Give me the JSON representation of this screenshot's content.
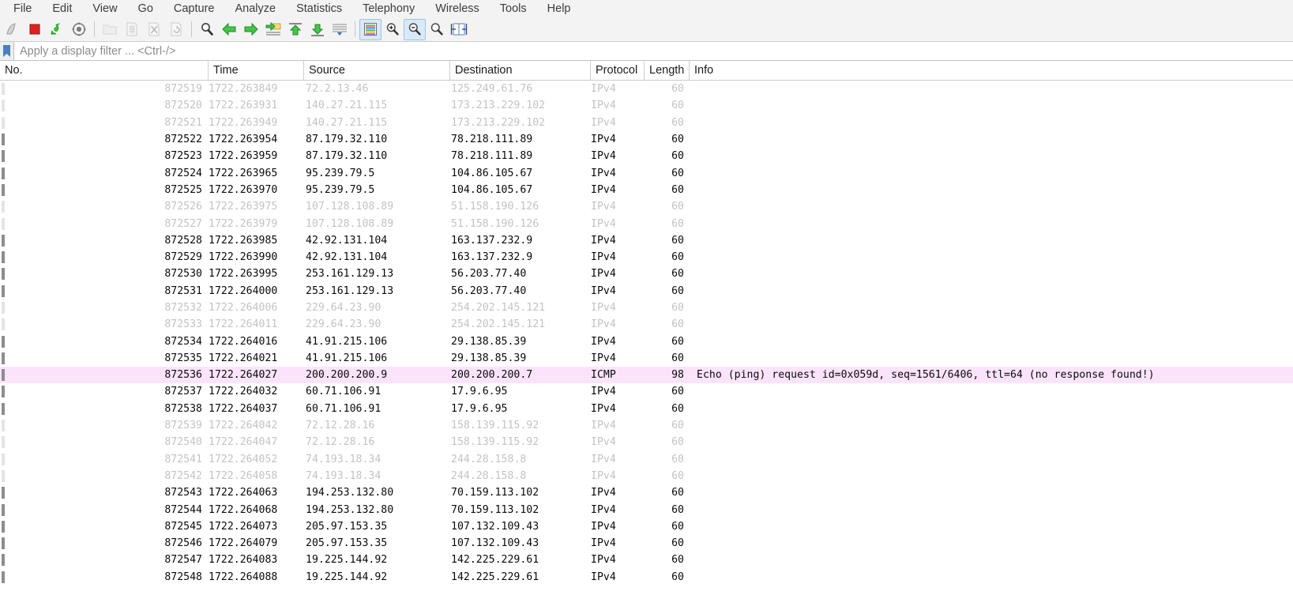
{
  "menu": {
    "items": [
      {
        "label": "File"
      },
      {
        "label": "Edit"
      },
      {
        "label": "View"
      },
      {
        "label": "Go"
      },
      {
        "label": "Capture"
      },
      {
        "label": "Analyze"
      },
      {
        "label": "Statistics"
      },
      {
        "label": "Telephony"
      },
      {
        "label": "Wireless"
      },
      {
        "label": "Tools"
      },
      {
        "label": "Help"
      }
    ]
  },
  "toolbar": {
    "buttons": [
      {
        "icon": "start-capture-shark-fin-icon",
        "state": "enabled"
      },
      {
        "icon": "stop-capture-square-icon",
        "state": "enabled"
      },
      {
        "icon": "restart-capture-icon",
        "state": "enabled"
      },
      {
        "icon": "capture-options-gear-icon",
        "state": "enabled"
      },
      {
        "icon": "open-file-folder-icon",
        "state": "disabled"
      },
      {
        "icon": "save-file-icon",
        "state": "disabled"
      },
      {
        "icon": "close-file-icon",
        "state": "disabled"
      },
      {
        "icon": "reload-file-icon",
        "state": "disabled"
      },
      {
        "icon": "find-packet-magnifier-icon",
        "state": "enabled"
      },
      {
        "icon": "go-back-arrow-icon",
        "state": "enabled"
      },
      {
        "icon": "go-forward-arrow-icon",
        "state": "enabled"
      },
      {
        "icon": "go-to-packet-icon",
        "state": "enabled"
      },
      {
        "icon": "go-to-first-packet-icon",
        "state": "enabled"
      },
      {
        "icon": "go-to-last-packet-icon",
        "state": "enabled"
      },
      {
        "icon": "auto-scroll-live-capture-icon",
        "state": "enabled"
      },
      {
        "icon": "colorize-packet-list-icon",
        "state": "active"
      },
      {
        "icon": "zoom-in-icon",
        "state": "enabled"
      },
      {
        "icon": "zoom-out-icon",
        "state": "active"
      },
      {
        "icon": "normal-size-icon",
        "state": "enabled"
      },
      {
        "icon": "resize-columns-icon",
        "state": "enabled"
      }
    ]
  },
  "filter": {
    "bookmark_icon": "bookmark-icon",
    "value": "",
    "placeholder": "Apply a display filter ... <Ctrl-/>"
  },
  "columns": [
    {
      "key": "no",
      "label": "No."
    },
    {
      "key": "time",
      "label": "Time"
    },
    {
      "key": "src",
      "label": "Source"
    },
    {
      "key": "dst",
      "label": "Destination"
    },
    {
      "key": "proto",
      "label": "Protocol"
    },
    {
      "key": "len",
      "label": "Length"
    },
    {
      "key": "info",
      "label": "Info"
    }
  ],
  "colors": {
    "icmp_row_highlight": "#fbe4fb",
    "toolbar_active": "#d8e9f8",
    "dim_text": "#c3c3c3",
    "text": "#0a0a0a"
  },
  "packets": [
    {
      "no": "872519",
      "time": "1722.263849",
      "src": "72.2.13.46",
      "dst": "125.249.61.76",
      "proto": "IPv4",
      "len": "60",
      "info": "",
      "dim": true,
      "highlight": false
    },
    {
      "no": "872520",
      "time": "1722.263931",
      "src": "140.27.21.115",
      "dst": "173.213.229.102",
      "proto": "IPv4",
      "len": "60",
      "info": "",
      "dim": true,
      "highlight": false
    },
    {
      "no": "872521",
      "time": "1722.263949",
      "src": "140.27.21.115",
      "dst": "173.213.229.102",
      "proto": "IPv4",
      "len": "60",
      "info": "",
      "dim": true,
      "highlight": false
    },
    {
      "no": "872522",
      "time": "1722.263954",
      "src": "87.179.32.110",
      "dst": "78.218.111.89",
      "proto": "IPv4",
      "len": "60",
      "info": "",
      "dim": false,
      "highlight": false
    },
    {
      "no": "872523",
      "time": "1722.263959",
      "src": "87.179.32.110",
      "dst": "78.218.111.89",
      "proto": "IPv4",
      "len": "60",
      "info": "",
      "dim": false,
      "highlight": false
    },
    {
      "no": "872524",
      "time": "1722.263965",
      "src": "95.239.79.5",
      "dst": "104.86.105.67",
      "proto": "IPv4",
      "len": "60",
      "info": "",
      "dim": false,
      "highlight": false
    },
    {
      "no": "872525",
      "time": "1722.263970",
      "src": "95.239.79.5",
      "dst": "104.86.105.67",
      "proto": "IPv4",
      "len": "60",
      "info": "",
      "dim": false,
      "highlight": false
    },
    {
      "no": "872526",
      "time": "1722.263975",
      "src": "107.128.108.89",
      "dst": "51.158.190.126",
      "proto": "IPv4",
      "len": "60",
      "info": "",
      "dim": true,
      "highlight": false
    },
    {
      "no": "872527",
      "time": "1722.263979",
      "src": "107.128.108.89",
      "dst": "51.158.190.126",
      "proto": "IPv4",
      "len": "60",
      "info": "",
      "dim": true,
      "highlight": false
    },
    {
      "no": "872528",
      "time": "1722.263985",
      "src": "42.92.131.104",
      "dst": "163.137.232.9",
      "proto": "IPv4",
      "len": "60",
      "info": "",
      "dim": false,
      "highlight": false
    },
    {
      "no": "872529",
      "time": "1722.263990",
      "src": "42.92.131.104",
      "dst": "163.137.232.9",
      "proto": "IPv4",
      "len": "60",
      "info": "",
      "dim": false,
      "highlight": false
    },
    {
      "no": "872530",
      "time": "1722.263995",
      "src": "253.161.129.13",
      "dst": "56.203.77.40",
      "proto": "IPv4",
      "len": "60",
      "info": "",
      "dim": false,
      "highlight": false
    },
    {
      "no": "872531",
      "time": "1722.264000",
      "src": "253.161.129.13",
      "dst": "56.203.77.40",
      "proto": "IPv4",
      "len": "60",
      "info": "",
      "dim": false,
      "highlight": false
    },
    {
      "no": "872532",
      "time": "1722.264006",
      "src": "229.64.23.90",
      "dst": "254.202.145.121",
      "proto": "IPv4",
      "len": "60",
      "info": "",
      "dim": true,
      "highlight": false
    },
    {
      "no": "872533",
      "time": "1722.264011",
      "src": "229.64.23.90",
      "dst": "254.202.145.121",
      "proto": "IPv4",
      "len": "60",
      "info": "",
      "dim": true,
      "highlight": false
    },
    {
      "no": "872534",
      "time": "1722.264016",
      "src": "41.91.215.106",
      "dst": "29.138.85.39",
      "proto": "IPv4",
      "len": "60",
      "info": "",
      "dim": false,
      "highlight": false
    },
    {
      "no": "872535",
      "time": "1722.264021",
      "src": "41.91.215.106",
      "dst": "29.138.85.39",
      "proto": "IPv4",
      "len": "60",
      "info": "",
      "dim": false,
      "highlight": false
    },
    {
      "no": "872536",
      "time": "1722.264027",
      "src": "200.200.200.9",
      "dst": "200.200.200.7",
      "proto": "ICMP",
      "len": "98",
      "info": "Echo (ping) request  id=0x059d, seq=1561/6406, ttl=64 (no response found!)",
      "dim": false,
      "highlight": true
    },
    {
      "no": "872537",
      "time": "1722.264032",
      "src": "60.71.106.91",
      "dst": "17.9.6.95",
      "proto": "IPv4",
      "len": "60",
      "info": "",
      "dim": false,
      "highlight": false
    },
    {
      "no": "872538",
      "time": "1722.264037",
      "src": "60.71.106.91",
      "dst": "17.9.6.95",
      "proto": "IPv4",
      "len": "60",
      "info": "",
      "dim": false,
      "highlight": false
    },
    {
      "no": "872539",
      "time": "1722.264042",
      "src": "72.12.28.16",
      "dst": "158.139.115.92",
      "proto": "IPv4",
      "len": "60",
      "info": "",
      "dim": true,
      "highlight": false
    },
    {
      "no": "872540",
      "time": "1722.264047",
      "src": "72.12.28.16",
      "dst": "158.139.115.92",
      "proto": "IPv4",
      "len": "60",
      "info": "",
      "dim": true,
      "highlight": false
    },
    {
      "no": "872541",
      "time": "1722.264052",
      "src": "74.193.18.34",
      "dst": "244.28.158.8",
      "proto": "IPv4",
      "len": "60",
      "info": "",
      "dim": true,
      "highlight": false
    },
    {
      "no": "872542",
      "time": "1722.264058",
      "src": "74.193.18.34",
      "dst": "244.28.158.8",
      "proto": "IPv4",
      "len": "60",
      "info": "",
      "dim": true,
      "highlight": false
    },
    {
      "no": "872543",
      "time": "1722.264063",
      "src": "194.253.132.80",
      "dst": "70.159.113.102",
      "proto": "IPv4",
      "len": "60",
      "info": "",
      "dim": false,
      "highlight": false
    },
    {
      "no": "872544",
      "time": "1722.264068",
      "src": "194.253.132.80",
      "dst": "70.159.113.102",
      "proto": "IPv4",
      "len": "60",
      "info": "",
      "dim": false,
      "highlight": false
    },
    {
      "no": "872545",
      "time": "1722.264073",
      "src": "205.97.153.35",
      "dst": "107.132.109.43",
      "proto": "IPv4",
      "len": "60",
      "info": "",
      "dim": false,
      "highlight": false
    },
    {
      "no": "872546",
      "time": "1722.264079",
      "src": "205.97.153.35",
      "dst": "107.132.109.43",
      "proto": "IPv4",
      "len": "60",
      "info": "",
      "dim": false,
      "highlight": false
    },
    {
      "no": "872547",
      "time": "1722.264083",
      "src": "19.225.144.92",
      "dst": "142.225.229.61",
      "proto": "IPv4",
      "len": "60",
      "info": "",
      "dim": false,
      "highlight": false
    },
    {
      "no": "872548",
      "time": "1722.264088",
      "src": "19.225.144.92",
      "dst": "142.225.229.61",
      "proto": "IPv4",
      "len": "60",
      "info": "",
      "dim": false,
      "highlight": false
    }
  ]
}
